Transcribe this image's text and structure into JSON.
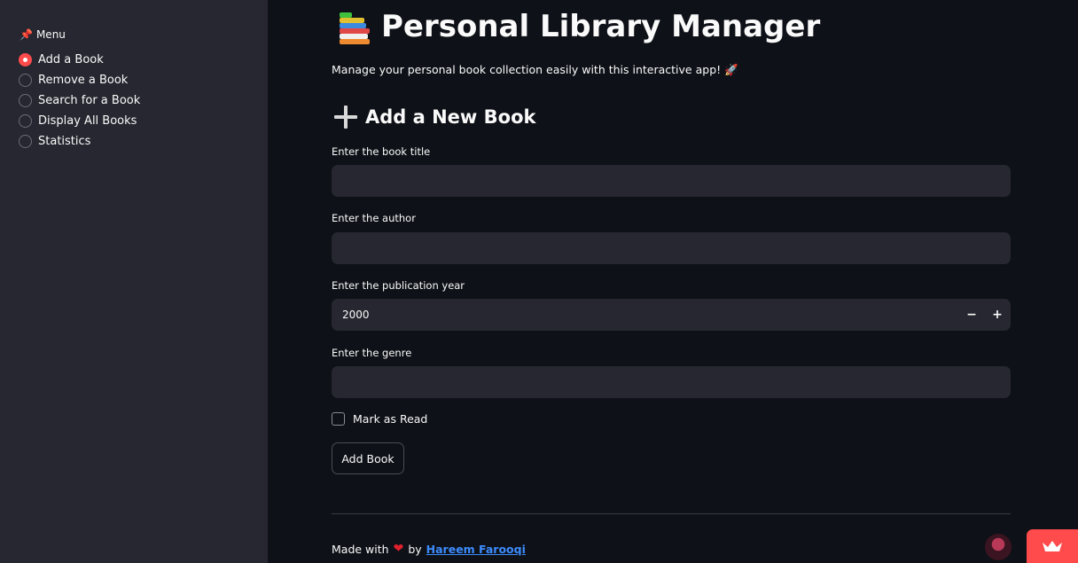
{
  "sidebar": {
    "menu_label": "Menu",
    "items": [
      {
        "label": "Add a Book",
        "selected": true
      },
      {
        "label": "Remove a Book",
        "selected": false
      },
      {
        "label": "Search for a Book",
        "selected": false
      },
      {
        "label": "Display All Books",
        "selected": false
      },
      {
        "label": "Statistics",
        "selected": false
      }
    ]
  },
  "header": {
    "title": "Personal Library Manager",
    "subtitle": "Manage your personal book collection easily with this interactive app! 🚀"
  },
  "section": {
    "title": "Add a New Book"
  },
  "form": {
    "title_label": "Enter the book title",
    "title_value": "",
    "author_label": "Enter the author",
    "author_value": "",
    "year_label": "Enter the publication year",
    "year_value": "2000",
    "decrement": "−",
    "increment": "+",
    "genre_label": "Enter the genre",
    "genre_value": "",
    "read_label": "Mark as Read",
    "submit_label": "Add Book"
  },
  "footer": {
    "prefix": "Made with",
    "by": "by",
    "author_link": "Hareem Farooqi"
  },
  "colors": {
    "accent": "#ff4b4b",
    "sidebar_bg": "#262730",
    "main_bg": "#0e1117",
    "link": "#3d8cff",
    "heart": "#e0202c"
  },
  "icons": {
    "menu": "pushpin-icon",
    "title": "books-icon",
    "section": "plus-icon",
    "footer": "heart-icon"
  }
}
